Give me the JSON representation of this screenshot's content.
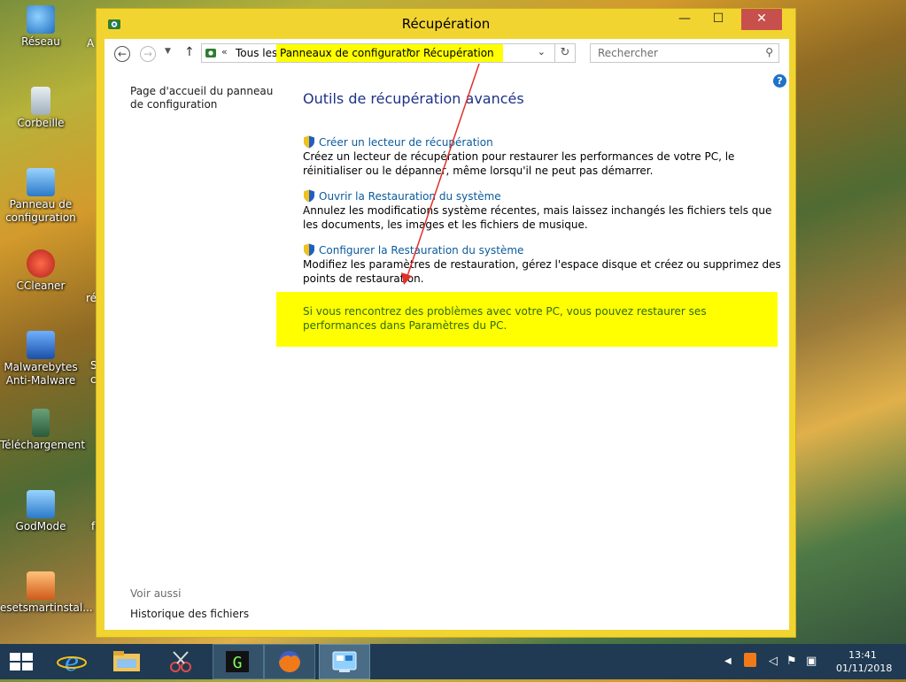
{
  "desktop": {
    "icons": [
      {
        "label": "Réseau",
        "color": "#3a8fd8"
      },
      {
        "label": "Corbeille",
        "color": "#cfd8e0"
      },
      {
        "label": "Panneau de configuration",
        "color": "#4aa0e0"
      },
      {
        "label": "CCleaner",
        "color": "#d23b2a"
      },
      {
        "label": "Malwarebytes Anti-Malware",
        "color": "#2f6fcf"
      },
      {
        "label": "Téléchargement",
        "color": "#3f7a4a"
      },
      {
        "label": "GodMode",
        "color": "#4aa0e0"
      },
      {
        "label": "esetsmartinstal...",
        "color": "#e06a2a"
      }
    ],
    "partial_labels": [
      "A",
      "ré",
      "S",
      "c",
      "fe"
    ]
  },
  "window": {
    "title": "Récupération",
    "caption": {
      "minimize": "—",
      "maximize": "☐",
      "close": "✕"
    },
    "toolbar": {
      "back_glyph": "←",
      "forward_glyph": "→",
      "recent_glyph": "▼",
      "up_glyph": "↑",
      "address": {
        "chevron": "«",
        "root": "Tous les",
        "crumbs": [
          "Panneaux de configuration",
          "Récupération"
        ],
        "separator": "▸",
        "dropdown": "⌄",
        "refresh_glyph": "↻"
      },
      "search": {
        "placeholder": "Rechercher",
        "icon": "⚲"
      }
    },
    "help_glyph": "?",
    "left_pane": {
      "home_link": "Page d'accueil du panneau de configuration",
      "see_also": "Voir aussi",
      "history_link": "Historique des fichiers"
    },
    "main": {
      "title": "Outils de récupération avancés",
      "items": [
        {
          "link": "Créer un lecteur de récupération",
          "desc": "Créez un lecteur de récupération pour restaurer les performances de votre PC, le réinitialiser ou le dépanner, même lorsqu'il ne peut pas démarrer."
        },
        {
          "link": "Ouvrir la Restauration du système",
          "desc": "Annulez les modifications système récentes, mais laissez inchangés les fichiers tels que les documents, les images et les fichiers de musique."
        },
        {
          "link": "Configurer la Restauration du système",
          "desc": "Modifiez les paramètres de restauration, gérez l'espace disque et créez ou supprimez des points de restauration."
        }
      ],
      "notice": "Si vous rencontrez des problèmes avec votre PC, vous pouvez restaurer ses performances dans Paramètres du PC."
    }
  },
  "taskbar": {
    "clock_time": "13:41",
    "clock_date": "01/11/2018"
  },
  "colors": {
    "highlight": "#ffff00",
    "link": "#0a5a9c",
    "title": "#1e3287",
    "arrow": "#e0302a",
    "window_border": "#f2d431"
  }
}
